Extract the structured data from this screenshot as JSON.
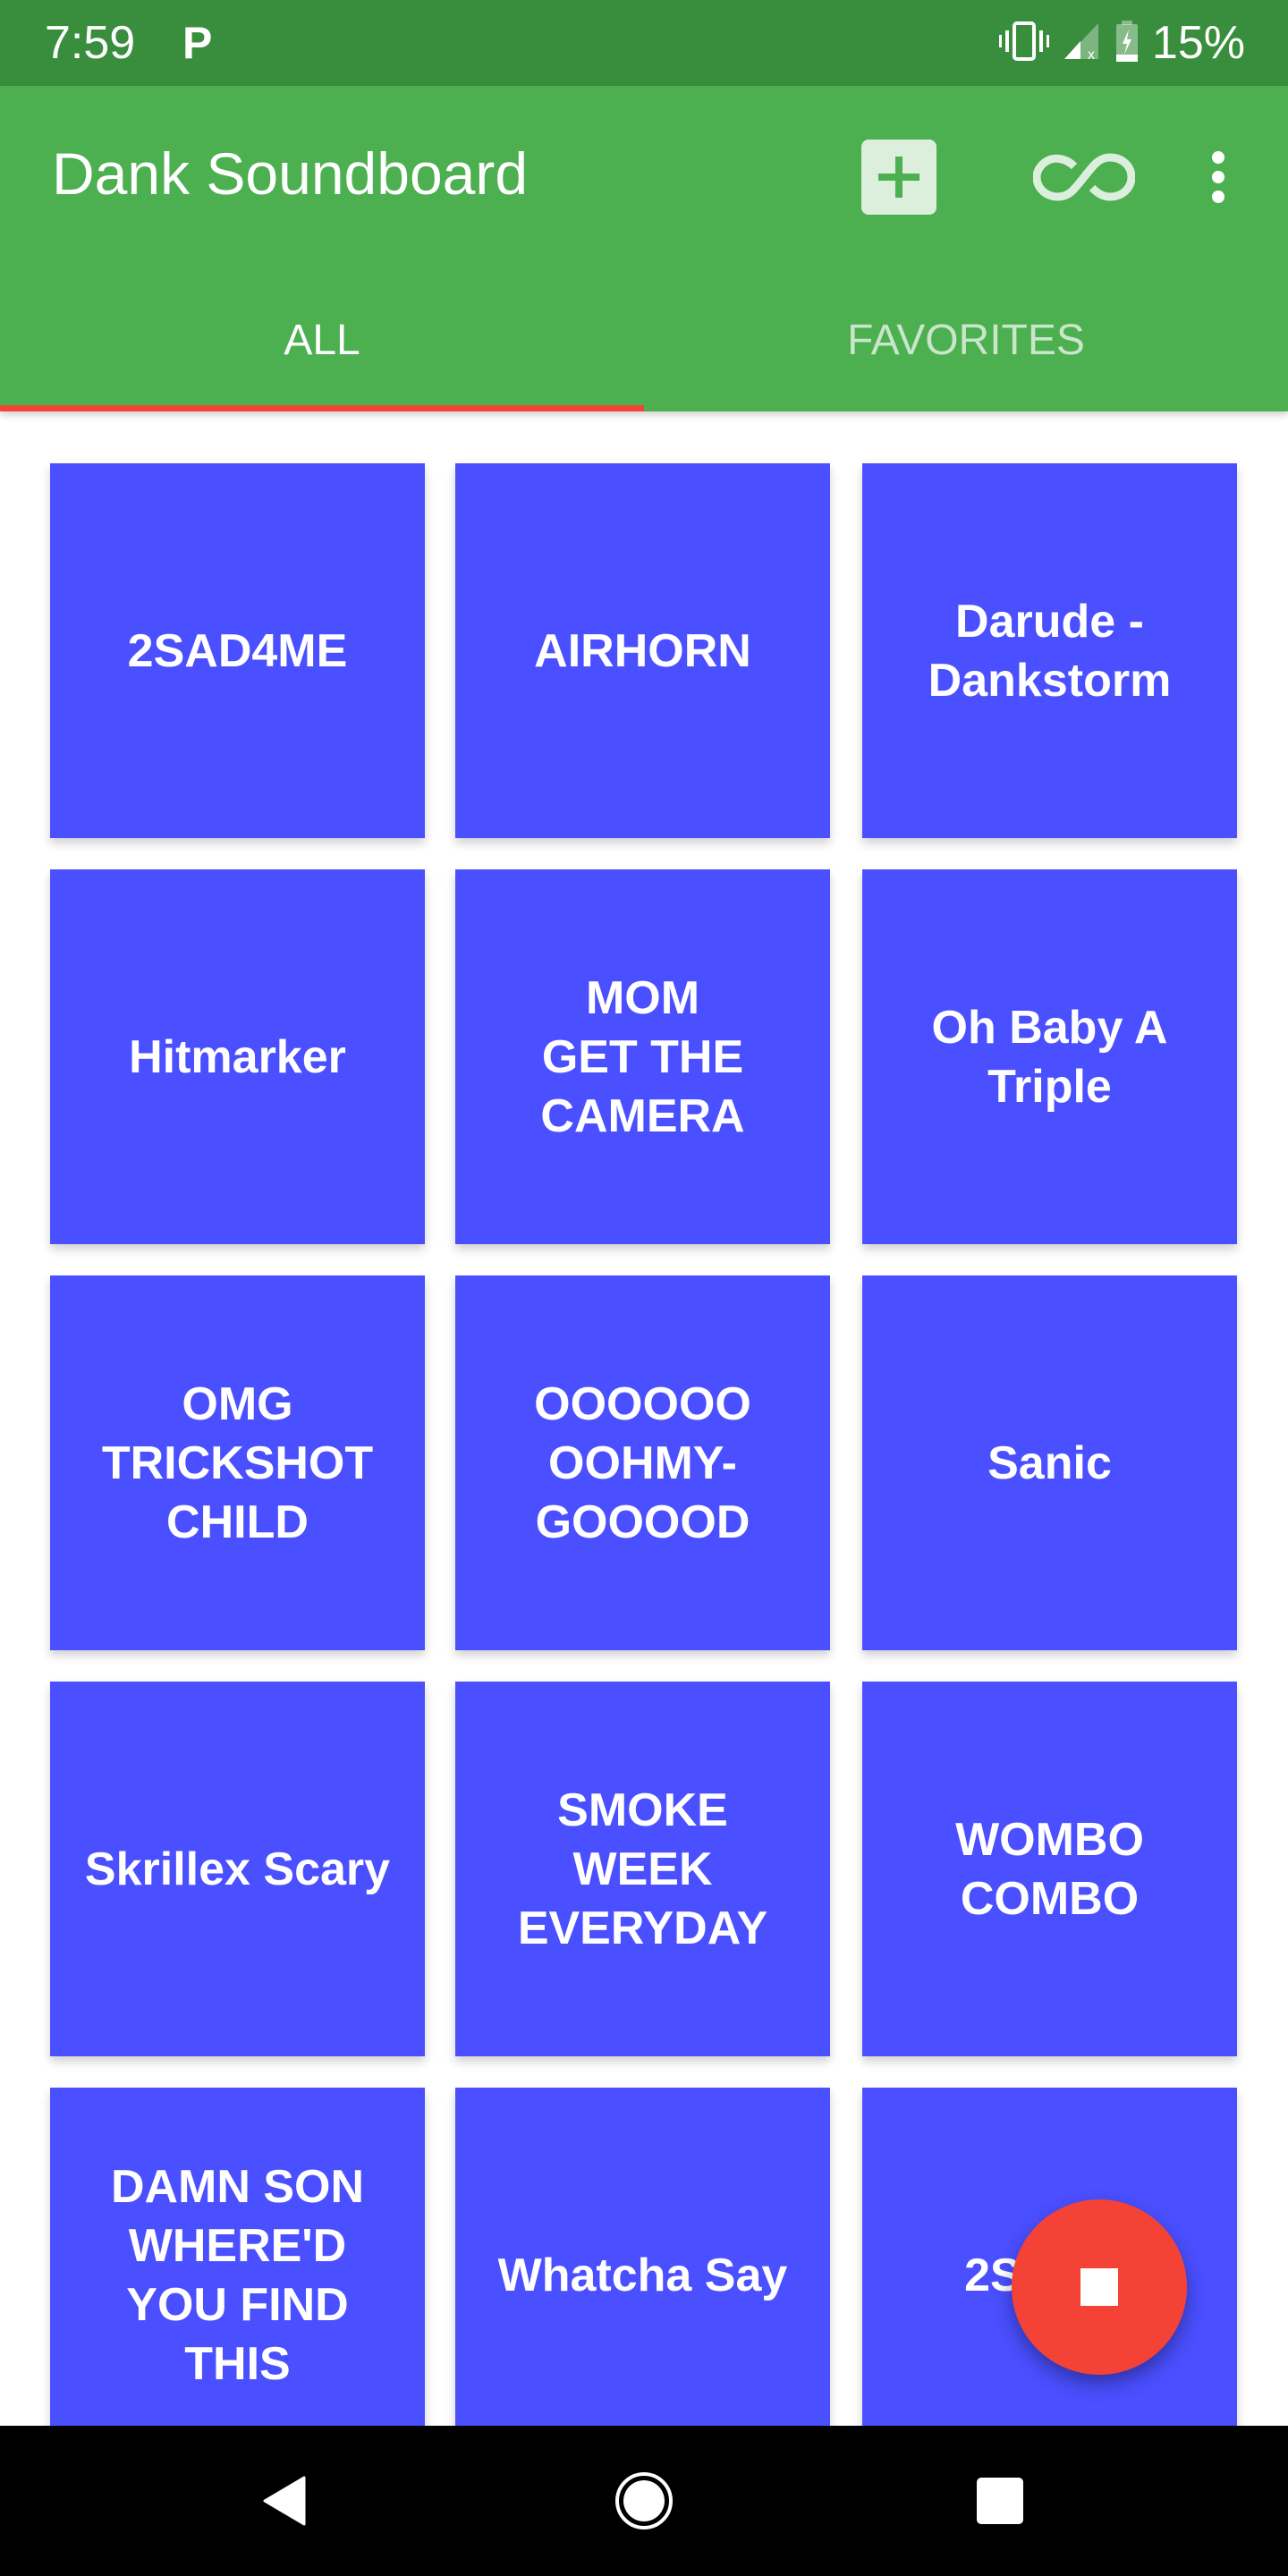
{
  "status_bar": {
    "time": "7:59",
    "notification_icon": "parking-icon",
    "notification_glyph": "P",
    "battery_percent": "15%",
    "icons": [
      "vibrate-icon",
      "signal-no-service-icon",
      "battery-charging-icon"
    ]
  },
  "app_bar": {
    "title": "Dank Soundboard",
    "actions": [
      {
        "name": "add-sound-button",
        "icon": "plus-box-icon"
      },
      {
        "name": "loop-button",
        "icon": "infinity-icon"
      },
      {
        "name": "overflow-menu-button",
        "icon": "more-vert-icon"
      }
    ]
  },
  "tabs": [
    {
      "label": "ALL",
      "active": true
    },
    {
      "label": "FAVORITES",
      "active": false
    }
  ],
  "sounds": [
    {
      "label": "2SAD4ME"
    },
    {
      "label": "AIRHORN"
    },
    {
      "label": "Darude -\nDankstorm"
    },
    {
      "label": "Hitmarker"
    },
    {
      "label": "MOM\nGET THE\nCAMERA"
    },
    {
      "label": "Oh Baby A\nTriple"
    },
    {
      "label": "OMG\nTRICKSHOT\nCHILD"
    },
    {
      "label": "OOOOOO\nOOHMY-\nGOOOOD"
    },
    {
      "label": "Sanic"
    },
    {
      "label": "Skrillex Scary"
    },
    {
      "label": "SMOKE\nWEEK\nEVERYDAY"
    },
    {
      "label": "WOMBO\nCOMBO"
    },
    {
      "label": "DAMN SON\nWHERE'D\nYOU FIND\nTHIS"
    },
    {
      "label": "Whatcha Say"
    },
    {
      "label": "2SED        O\n "
    }
  ],
  "fab": {
    "icon": "stop-icon",
    "label": "Stop"
  },
  "nav_bar": {
    "buttons": [
      "back-icon",
      "home-icon",
      "recents-icon"
    ]
  },
  "colors": {
    "status_bar": "#388e3c",
    "app_bar": "#4caf50",
    "tab_indicator": "#f44336",
    "tile": "#4a4fff",
    "fab": "#f44336"
  }
}
